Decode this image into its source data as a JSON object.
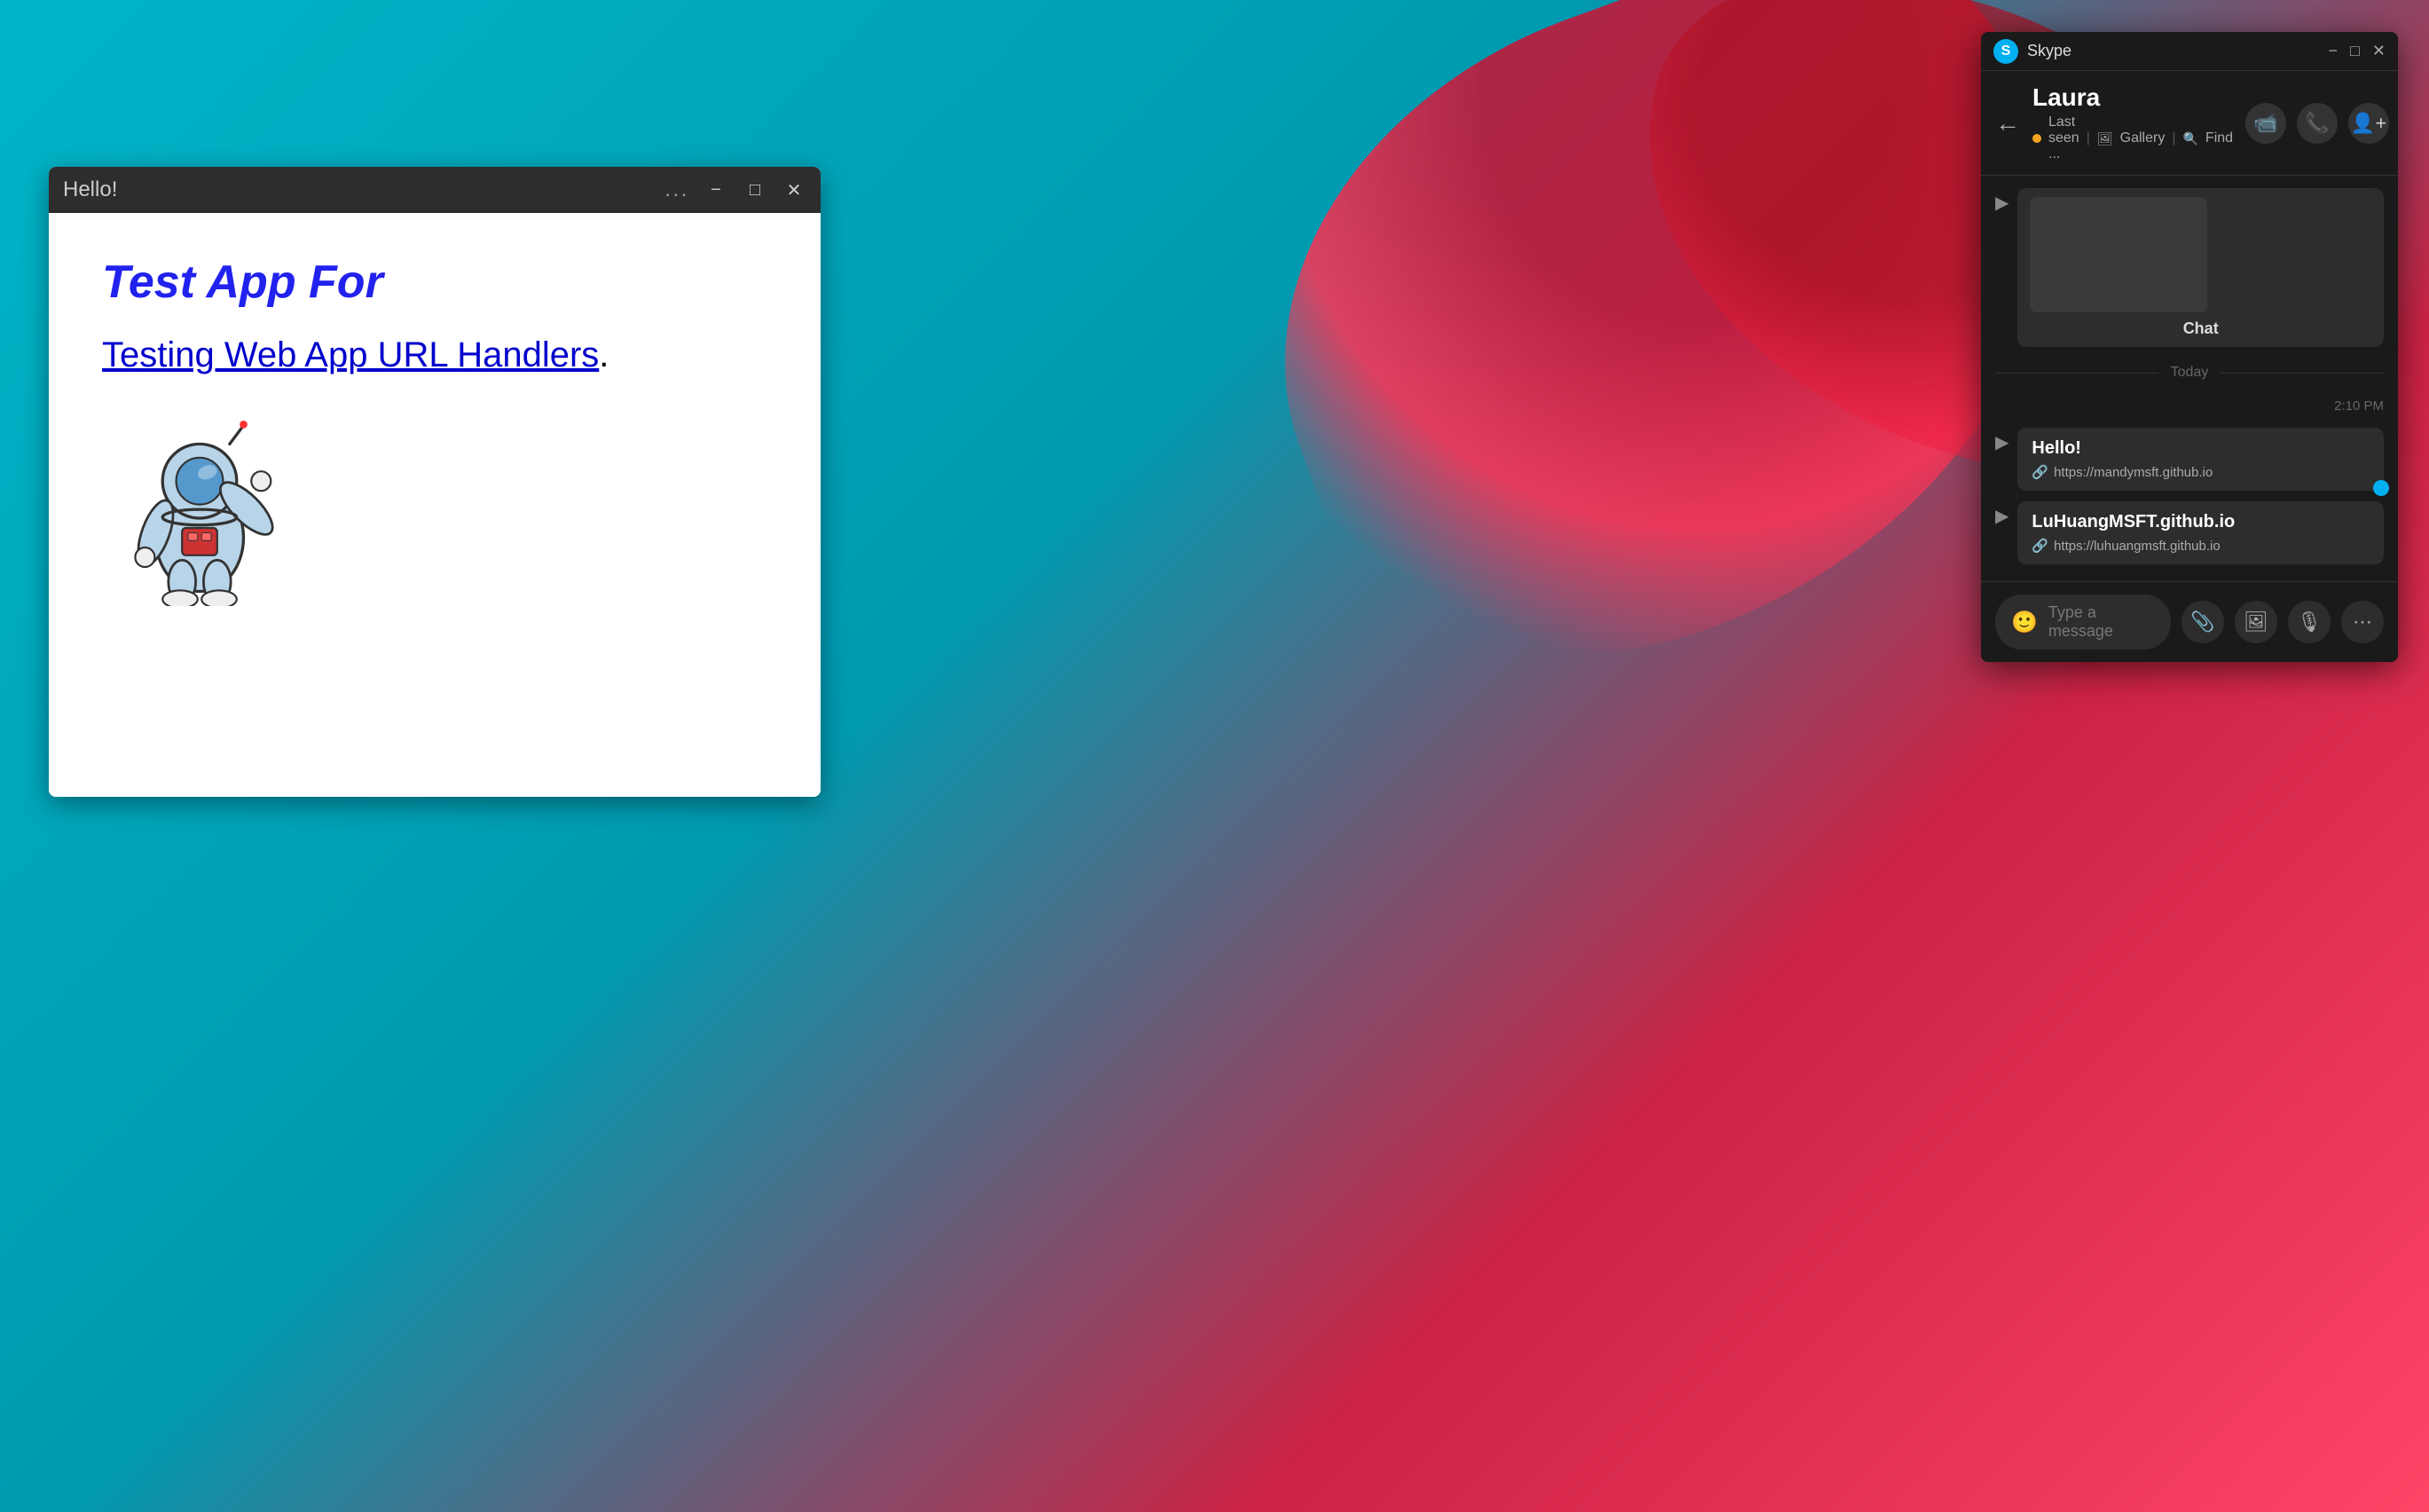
{
  "desktop": {
    "background": "teal-floral"
  },
  "browser_window": {
    "title": "Hello!",
    "dots_label": "...",
    "minimize_label": "−",
    "maximize_label": "□",
    "close_label": "✕",
    "app_title": "Test App For",
    "app_link_text": "Testing Web App URL Handlers",
    "app_link_suffix": "."
  },
  "skype_window": {
    "app_name": "Skype",
    "logo_letter": "S",
    "minimize_label": "−",
    "maximize_label": "□",
    "close_label": "✕",
    "contact_name": "Laura",
    "status_text": "Last seen ...",
    "gallery_label": "Gallery",
    "find_label": "Find",
    "back_arrow": "←",
    "chat_card_label": "Chat",
    "today_label": "Today",
    "timestamp": "2:10 PM",
    "message1_title": "Hello!",
    "message1_link": "https://mandymsft.github.io",
    "message2_title": "LuHuangMSFT.github.io",
    "message2_link": "https://luhuangmsft.github.io",
    "input_placeholder": "Type a message"
  },
  "icons": {
    "video_call": "📹",
    "phone_call": "📞",
    "add_contact": "👤",
    "emoji": "🙂",
    "attachment": "📎",
    "image": "🖼",
    "microphone": "🎙",
    "more": "⋯",
    "gallery": "🖼",
    "find": "🔍",
    "send_arrow": "▶",
    "link": "🔗"
  }
}
